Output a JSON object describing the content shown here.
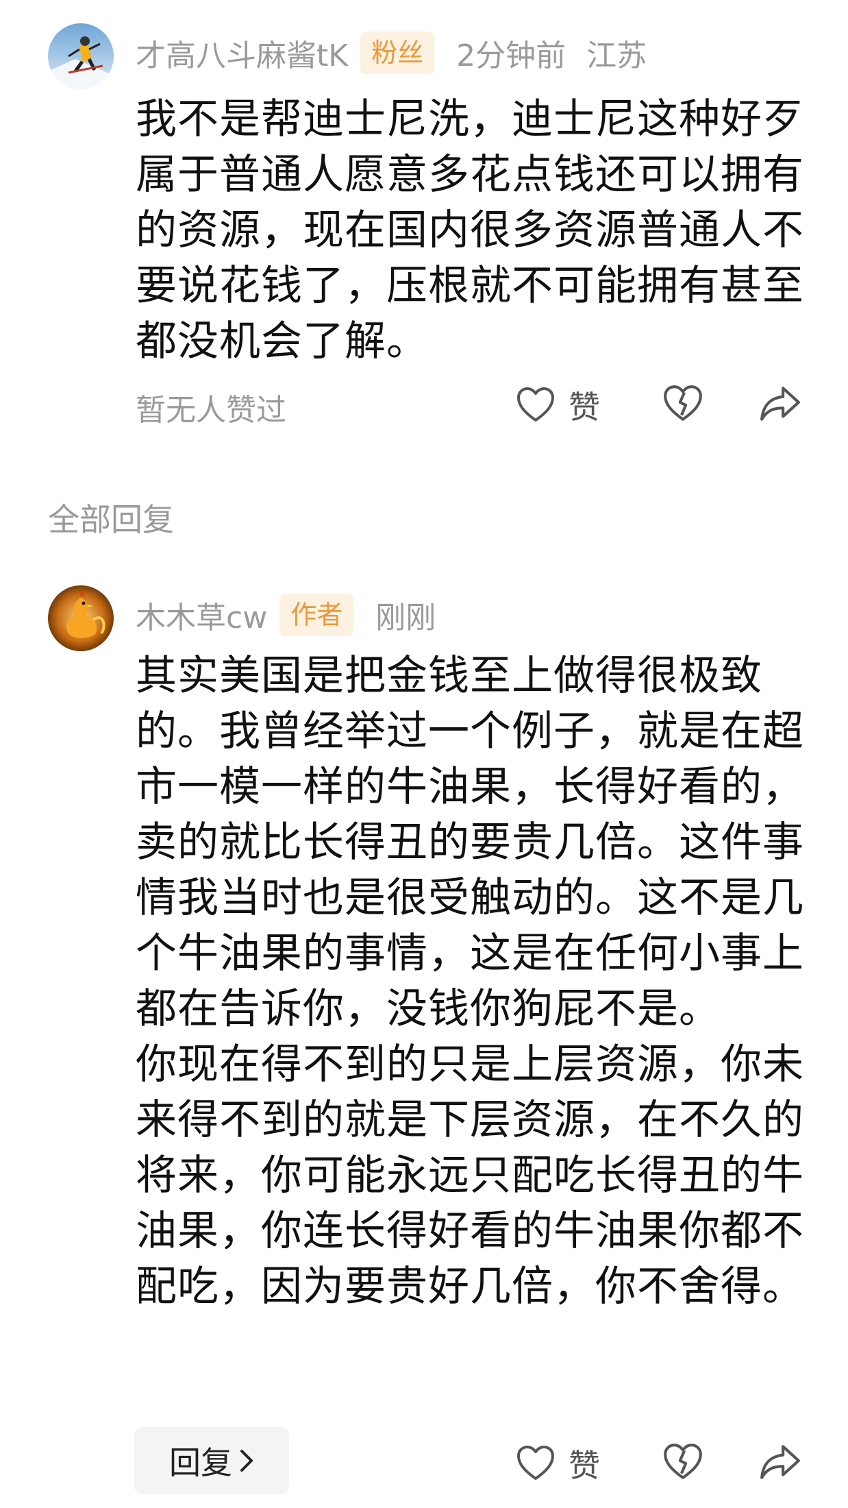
{
  "comments": [
    {
      "username": "才高八斗麻酱tK",
      "badge": "粉丝",
      "time": "2分钟前",
      "location": "江苏",
      "paragraphs": [
        "我不是帮迪士尼洗，迪士尼这种好歹属于普通人愿意多花点钱还可以拥有的资源，现在国内很多资源普通人不要说花钱了，压根就不可能拥有甚至都没机会了解。"
      ],
      "likes_text": "暂无人赞过",
      "like_label": "赞"
    },
    {
      "username": "木木草cw",
      "badge": "作者",
      "time": "刚刚",
      "paragraphs": [
        "其实美国是把金钱至上做得很极致的。我曾经举过一个例子，就是在超市一模一样的牛油果，长得好看的，卖的就比长得丑的要贵几倍。这件事情我当时也是很受触动的。这不是几个牛油果的事情，这是在任何小事上都在告诉你，没钱你狗屁不是。",
        "你现在得不到的只是上层资源，你未来得不到的就是下层资源，在不久的将来，你可能永远只配吃长得丑的牛油果，你连长得好看的牛油果你都不配吃，因为要贵好几倍，你不舍得。"
      ],
      "reply_label": "回复",
      "like_label": "赞"
    }
  ],
  "section_title": "全部回复",
  "colors": {
    "badge_bg": "#fdf1e1",
    "badge_text": "#e89a3c",
    "meta_text": "#9a9a9a"
  },
  "icons": [
    "heart-icon",
    "heartbreak-icon",
    "share-icon",
    "chevron-right-icon"
  ]
}
